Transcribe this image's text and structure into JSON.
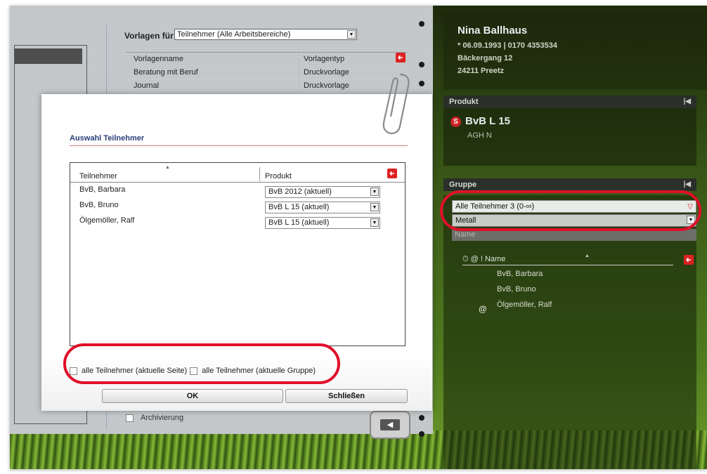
{
  "person": {
    "name": "Nina Ballhaus",
    "birth_phone": "* 06.09.1993 | 0170 4353534",
    "street": "Bäckergang 12",
    "city": "24211 Preetz"
  },
  "product_section": {
    "header": "Produkt",
    "badge": "S",
    "name": "BvB L 15",
    "sub": "AGH N"
  },
  "group_section": {
    "header": "Gruppe",
    "select_participants": "Alle Teilnehmer 3 (0-∞)",
    "select_group": "Metall",
    "name_placeholder": "Name",
    "list_header": "Name",
    "list_icons": "⏱ @ !",
    "members": [
      "BvB, Barbara",
      "BvB, Bruno",
      "Ölgemöller, Ralf"
    ],
    "at_marker": "@"
  },
  "templates": {
    "label": "Vorlagen für",
    "select_value": "Teilnehmer (Alle Arbeitsbereiche)",
    "columns": [
      "Vorlagenname",
      "Vorlagentyp"
    ],
    "rows": [
      [
        "Beratung mit Beruf",
        "Druckvorlage"
      ],
      [
        "Journal",
        "Druckvorlage"
      ]
    ],
    "archive_label": "Archivierung"
  },
  "dialog": {
    "title": "Auswahl Teilnehmer",
    "columns": [
      "Teilnehmer",
      "Produkt"
    ],
    "rows": [
      {
        "name": "BvB, Barbara",
        "product": "BvB 2012 (aktuell)"
      },
      {
        "name": "BvB, Bruno",
        "product": "BvB L 15 (aktuell)"
      },
      {
        "name": "Ölgemöller, Ralf",
        "product": "BvB L 15 (aktuell)"
      }
    ],
    "check_page": "alle Teilnehmer (aktuelle Seite)",
    "check_group": "alle Teilnehmer (aktuelle Gruppe)",
    "ok": "OK",
    "close": "Schließen"
  },
  "colors": {
    "annotation_red": "#e0102a",
    "title_blue": "#2a3f7a",
    "reset_red": "#dd2222"
  }
}
